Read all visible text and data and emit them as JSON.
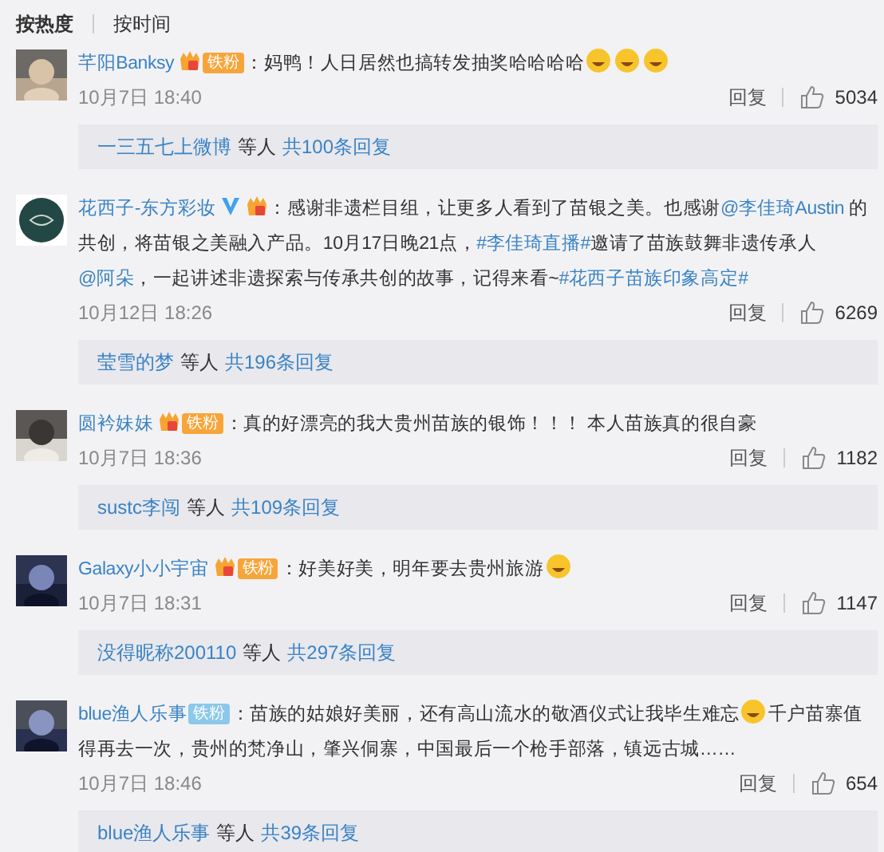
{
  "tabs": [
    {
      "label": "按热度",
      "selected": true
    },
    {
      "label": "按时间",
      "selected": false
    }
  ],
  "comments": [
    {
      "avatar": {
        "kind": "picture"
      },
      "name": "芊阳Banksy",
      "verified": false,
      "fan_icon": true,
      "badge": {
        "text": "铁粉",
        "color": "#f7a53a"
      },
      "segments": [
        {
          "kind": "text",
          "text": "：妈鸭！人日居然也搞转发抽奖哈哈哈哈"
        },
        {
          "kind": "emoji"
        },
        {
          "kind": "emoji"
        },
        {
          "kind": "emoji"
        }
      ],
      "date": "10月7日 18:40",
      "reply": "回复",
      "likes": "5034",
      "thread": {
        "users": "一三五七上微博",
        "joiner": "等人",
        "total": "共100条回复"
      }
    },
    {
      "avatar": {
        "kind": "logo"
      },
      "name": "花西子-东方彩妆",
      "verified": true,
      "fan_icon": true,
      "segments": [
        {
          "kind": "text",
          "text": "：感谢非遗栏目组，让更多人看到了苗银之美。也感谢"
        },
        {
          "kind": "link",
          "text": "@李佳琦Austin"
        },
        {
          "kind": "text",
          "text": " 的共创，将苗银之美融入产品。10月17日晚21点，"
        },
        {
          "kind": "link",
          "text": "#李佳琦直播#"
        },
        {
          "kind": "text",
          "text": "邀请了苗族鼓舞非遗传承人"
        },
        {
          "kind": "link",
          "text": "@阿朵"
        },
        {
          "kind": "text",
          "text": "，一起讲述非遗探索与传承共创的故事，记得来看~"
        },
        {
          "kind": "link",
          "text": "#花西子苗族印象高定#"
        }
      ],
      "date": "10月12日 18:26",
      "reply": "回复",
      "likes": "6269",
      "thread": {
        "users": "莹雪的梦",
        "joiner": "等人",
        "total": "共196条回复"
      }
    },
    {
      "avatar": {
        "kind": "picture"
      },
      "name": "圆衿妹妹",
      "verified": false,
      "fan_icon": true,
      "badge": {
        "text": "铁粉",
        "color": "#f7a53a"
      },
      "segments": [
        {
          "kind": "text",
          "text": "：真的好漂亮的我大贵州苗族的银饰！！！ 本人苗族真的很自豪"
        }
      ],
      "date": "10月7日 18:36",
      "reply": "回复",
      "likes": "1182",
      "thread": {
        "users": "sustc李闯",
        "joiner": "等人",
        "total": "共109条回复"
      }
    },
    {
      "avatar": {
        "kind": "picture"
      },
      "name": "Galaxy小小宇宙",
      "verified": false,
      "fan_icon": true,
      "badge": {
        "text": "铁粉",
        "color": "#f7a53a"
      },
      "segments": [
        {
          "kind": "text",
          "text": "：好美好美，明年要去贵州旅游"
        },
        {
          "kind": "emoji"
        }
      ],
      "date": "10月7日 18:31",
      "reply": "回复",
      "likes": "1147",
      "thread": {
        "users": "没得昵称200110",
        "joiner": "等人",
        "total": "共297条回复"
      }
    },
    {
      "avatar": {
        "kind": "picture"
      },
      "name": "blue渔人乐事",
      "verified": false,
      "fan_icon": false,
      "badge": {
        "text": "铁粉",
        "color": "#8cc8ea"
      },
      "segments": [
        {
          "kind": "text",
          "text": "：苗族的姑娘好美丽，还有高山流水的敬酒仪式让我毕生难忘"
        },
        {
          "kind": "emoji"
        },
        {
          "kind": "text",
          "text": "千户苗寨值得再去一次，贵州的梵净山，肇兴侗寨，中国最后一个枪手部落，镇远古城……"
        }
      ],
      "date": "10月7日 18:46",
      "reply": "回复",
      "likes": "654",
      "thread": {
        "users": "blue渔人乐事",
        "joiner": "等人",
        "total": "共39条回复"
      }
    }
  ]
}
